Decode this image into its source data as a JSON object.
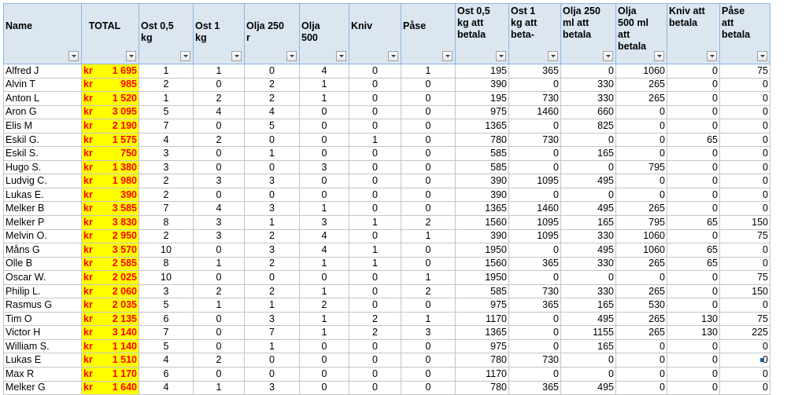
{
  "columns": [
    {
      "key": "name",
      "label": "Name"
    },
    {
      "key": "total",
      "label": "TOTAL"
    },
    {
      "key": "ost05",
      "label": "Ost 0,5 kg"
    },
    {
      "key": "ost1",
      "label": "Ost 1 kg"
    },
    {
      "key": "olja250",
      "label": "Olja 250 r"
    },
    {
      "key": "olja500",
      "label": "Olja 500"
    },
    {
      "key": "kniv",
      "label": "Kniv"
    },
    {
      "key": "pase",
      "label": "Påse"
    },
    {
      "key": "ost05_pay",
      "label": "Ost 0,5 kg att betala"
    },
    {
      "key": "ost1_pay",
      "label": "Ost 1 kg att beta‑"
    },
    {
      "key": "olja250_pay",
      "label": "Olja 250 ml att betala"
    },
    {
      "key": "olja500_pay",
      "label": "Olja 500 ml att betala"
    },
    {
      "key": "kniv_pay",
      "label": "Kniv att betala"
    },
    {
      "key": "pase_pay",
      "label": "Påse att betala"
    }
  ],
  "currency": "kr",
  "rows": [
    {
      "name": "Alfred J",
      "total": "1 695",
      "ost05": "1",
      "ost1": "1",
      "olja250": "0",
      "olja500": "4",
      "kniv": "0",
      "pase": "1",
      "ost05_pay": "195",
      "ost1_pay": "365",
      "olja250_pay": "0",
      "olja500_pay": "1060",
      "kniv_pay": "0",
      "pase_pay": "75"
    },
    {
      "name": "Alvin T",
      "total": "985",
      "ost05": "2",
      "ost1": "0",
      "olja250": "2",
      "olja500": "1",
      "kniv": "0",
      "pase": "0",
      "ost05_pay": "390",
      "ost1_pay": "0",
      "olja250_pay": "330",
      "olja500_pay": "265",
      "kniv_pay": "0",
      "pase_pay": "0"
    },
    {
      "name": "Anton L",
      "total": "1 520",
      "ost05": "1",
      "ost1": "2",
      "olja250": "2",
      "olja500": "1",
      "kniv": "0",
      "pase": "0",
      "ost05_pay": "195",
      "ost1_pay": "730",
      "olja250_pay": "330",
      "olja500_pay": "265",
      "kniv_pay": "0",
      "pase_pay": "0"
    },
    {
      "name": "Aron G",
      "total": "3 095",
      "ost05": "5",
      "ost1": "4",
      "olja250": "4",
      "olja500": "0",
      "kniv": "0",
      "pase": "0",
      "ost05_pay": "975",
      "ost1_pay": "1460",
      "olja250_pay": "660",
      "olja500_pay": "0",
      "kniv_pay": "0",
      "pase_pay": "0"
    },
    {
      "name": "Elis M",
      "total": "2 190",
      "ost05": "7",
      "ost1": "0",
      "olja250": "5",
      "olja500": "0",
      "kniv": "0",
      "pase": "0",
      "ost05_pay": "1365",
      "ost1_pay": "0",
      "olja250_pay": "825",
      "olja500_pay": "0",
      "kniv_pay": "0",
      "pase_pay": "0"
    },
    {
      "name": "Eskil G.",
      "total": "1 575",
      "ost05": "4",
      "ost1": "2",
      "olja250": "0",
      "olja500": "0",
      "kniv": "1",
      "pase": "0",
      "ost05_pay": "780",
      "ost1_pay": "730",
      "olja250_pay": "0",
      "olja500_pay": "0",
      "kniv_pay": "65",
      "pase_pay": "0"
    },
    {
      "name": "Eskil S.",
      "total": "750",
      "ost05": "3",
      "ost1": "0",
      "olja250": "1",
      "olja500": "0",
      "kniv": "0",
      "pase": "0",
      "ost05_pay": "585",
      "ost1_pay": "0",
      "olja250_pay": "165",
      "olja500_pay": "0",
      "kniv_pay": "0",
      "pase_pay": "0"
    },
    {
      "name": "Hugo S.",
      "total": "1 380",
      "ost05": "3",
      "ost1": "0",
      "olja250": "0",
      "olja500": "3",
      "kniv": "0",
      "pase": "0",
      "ost05_pay": "585",
      "ost1_pay": "0",
      "olja250_pay": "0",
      "olja500_pay": "795",
      "kniv_pay": "0",
      "pase_pay": "0"
    },
    {
      "name": "Ludvig C.",
      "total": "1 980",
      "ost05": "2",
      "ost1": "3",
      "olja250": "3",
      "olja500": "0",
      "kniv": "0",
      "pase": "0",
      "ost05_pay": "390",
      "ost1_pay": "1095",
      "olja250_pay": "495",
      "olja500_pay": "0",
      "kniv_pay": "0",
      "pase_pay": "0"
    },
    {
      "name": "Lukas E.",
      "total": "390",
      "ost05": "2",
      "ost1": "0",
      "olja250": "0",
      "olja500": "0",
      "kniv": "0",
      "pase": "0",
      "ost05_pay": "390",
      "ost1_pay": "0",
      "olja250_pay": "0",
      "olja500_pay": "0",
      "kniv_pay": "0",
      "pase_pay": "0"
    },
    {
      "name": "Melker B",
      "total": "3 585",
      "ost05": "7",
      "ost1": "4",
      "olja250": "3",
      "olja500": "1",
      "kniv": "0",
      "pase": "0",
      "ost05_pay": "1365",
      "ost1_pay": "1460",
      "olja250_pay": "495",
      "olja500_pay": "265",
      "kniv_pay": "0",
      "pase_pay": "0"
    },
    {
      "name": "Melker P",
      "total": "3 830",
      "ost05": "8",
      "ost1": "3",
      "olja250": "1",
      "olja500": "3",
      "kniv": "1",
      "pase": "2",
      "ost05_pay": "1560",
      "ost1_pay": "1095",
      "olja250_pay": "165",
      "olja500_pay": "795",
      "kniv_pay": "65",
      "pase_pay": "150"
    },
    {
      "name": "Melvin O.",
      "total": "2 950",
      "ost05": "2",
      "ost1": "3",
      "olja250": "2",
      "olja500": "4",
      "kniv": "0",
      "pase": "1",
      "ost05_pay": "390",
      "ost1_pay": "1095",
      "olja250_pay": "330",
      "olja500_pay": "1060",
      "kniv_pay": "0",
      "pase_pay": "75"
    },
    {
      "name": "Måns G",
      "total": "3 570",
      "ost05": "10",
      "ost1": "0",
      "olja250": "3",
      "olja500": "4",
      "kniv": "1",
      "pase": "0",
      "ost05_pay": "1950",
      "ost1_pay": "0",
      "olja250_pay": "495",
      "olja500_pay": "1060",
      "kniv_pay": "65",
      "pase_pay": "0"
    },
    {
      "name": "Olle B",
      "total": "2 585",
      "ost05": "8",
      "ost1": "1",
      "olja250": "2",
      "olja500": "1",
      "kniv": "1",
      "pase": "0",
      "ost05_pay": "1560",
      "ost1_pay": "365",
      "olja250_pay": "330",
      "olja500_pay": "265",
      "kniv_pay": "65",
      "pase_pay": "0"
    },
    {
      "name": "Oscar W.",
      "total": "2 025",
      "ost05": "10",
      "ost1": "0",
      "olja250": "0",
      "olja500": "0",
      "kniv": "0",
      "pase": "1",
      "ost05_pay": "1950",
      "ost1_pay": "0",
      "olja250_pay": "0",
      "olja500_pay": "0",
      "kniv_pay": "0",
      "pase_pay": "75"
    },
    {
      "name": "Philip L.",
      "total": "2 060",
      "ost05": "3",
      "ost1": "2",
      "olja250": "2",
      "olja500": "1",
      "kniv": "0",
      "pase": "2",
      "ost05_pay": "585",
      "ost1_pay": "730",
      "olja250_pay": "330",
      "olja500_pay": "265",
      "kniv_pay": "0",
      "pase_pay": "150"
    },
    {
      "name": "Rasmus G",
      "total": "2 035",
      "ost05": "5",
      "ost1": "1",
      "olja250": "1",
      "olja500": "2",
      "kniv": "0",
      "pase": "0",
      "ost05_pay": "975",
      "ost1_pay": "365",
      "olja250_pay": "165",
      "olja500_pay": "530",
      "kniv_pay": "0",
      "pase_pay": "0"
    },
    {
      "name": "Tim O",
      "total": "2 135",
      "ost05": "6",
      "ost1": "0",
      "olja250": "3",
      "olja500": "1",
      "kniv": "2",
      "pase": "1",
      "ost05_pay": "1170",
      "ost1_pay": "0",
      "olja250_pay": "495",
      "olja500_pay": "265",
      "kniv_pay": "130",
      "pase_pay": "75"
    },
    {
      "name": "Victor H",
      "total": "3 140",
      "ost05": "7",
      "ost1": "0",
      "olja250": "7",
      "olja500": "1",
      "kniv": "2",
      "pase": "3",
      "ost05_pay": "1365",
      "ost1_pay": "0",
      "olja250_pay": "1155",
      "olja500_pay": "265",
      "kniv_pay": "130",
      "pase_pay": "225"
    },
    {
      "name": "William S.",
      "total": "1 140",
      "ost05": "5",
      "ost1": "0",
      "olja250": "1",
      "olja500": "0",
      "kniv": "0",
      "pase": "0",
      "ost05_pay": "975",
      "ost1_pay": "0",
      "olja250_pay": "165",
      "olja500_pay": "0",
      "kniv_pay": "0",
      "pase_pay": "0"
    },
    {
      "name": "Lukas E",
      "total": "1 510",
      "ost05": "4",
      "ost1": "2",
      "olja250": "0",
      "olja500": "0",
      "kniv": "0",
      "pase": "0",
      "ost05_pay": "780",
      "ost1_pay": "730",
      "olja250_pay": "0",
      "olja500_pay": "0",
      "kniv_pay": "0",
      "pase_pay": "0"
    },
    {
      "name": "Max R",
      "total": "1 170",
      "ost05": "6",
      "ost1": "0",
      "olja250": "0",
      "olja500": "0",
      "kniv": "0",
      "pase": "0",
      "ost05_pay": "1170",
      "ost1_pay": "0",
      "olja250_pay": "0",
      "olja500_pay": "0",
      "kniv_pay": "0",
      "pase_pay": "0"
    },
    {
      "name": "Melker G",
      "total": "1 640",
      "ost05": "4",
      "ost1": "1",
      "olja250": "3",
      "olja500": "0",
      "kniv": "0",
      "pase": "0",
      "ost05_pay": "780",
      "ost1_pay": "365",
      "olja250_pay": "495",
      "olja500_pay": "0",
      "kniv_pay": "0",
      "pase_pay": "0"
    }
  ],
  "colors": {
    "header_bg": "#dce6f1",
    "header_border": "#8db4e2",
    "total_bg": "#ffff00",
    "total_text": "#ff0000",
    "gridline": "#c5c5c5"
  }
}
